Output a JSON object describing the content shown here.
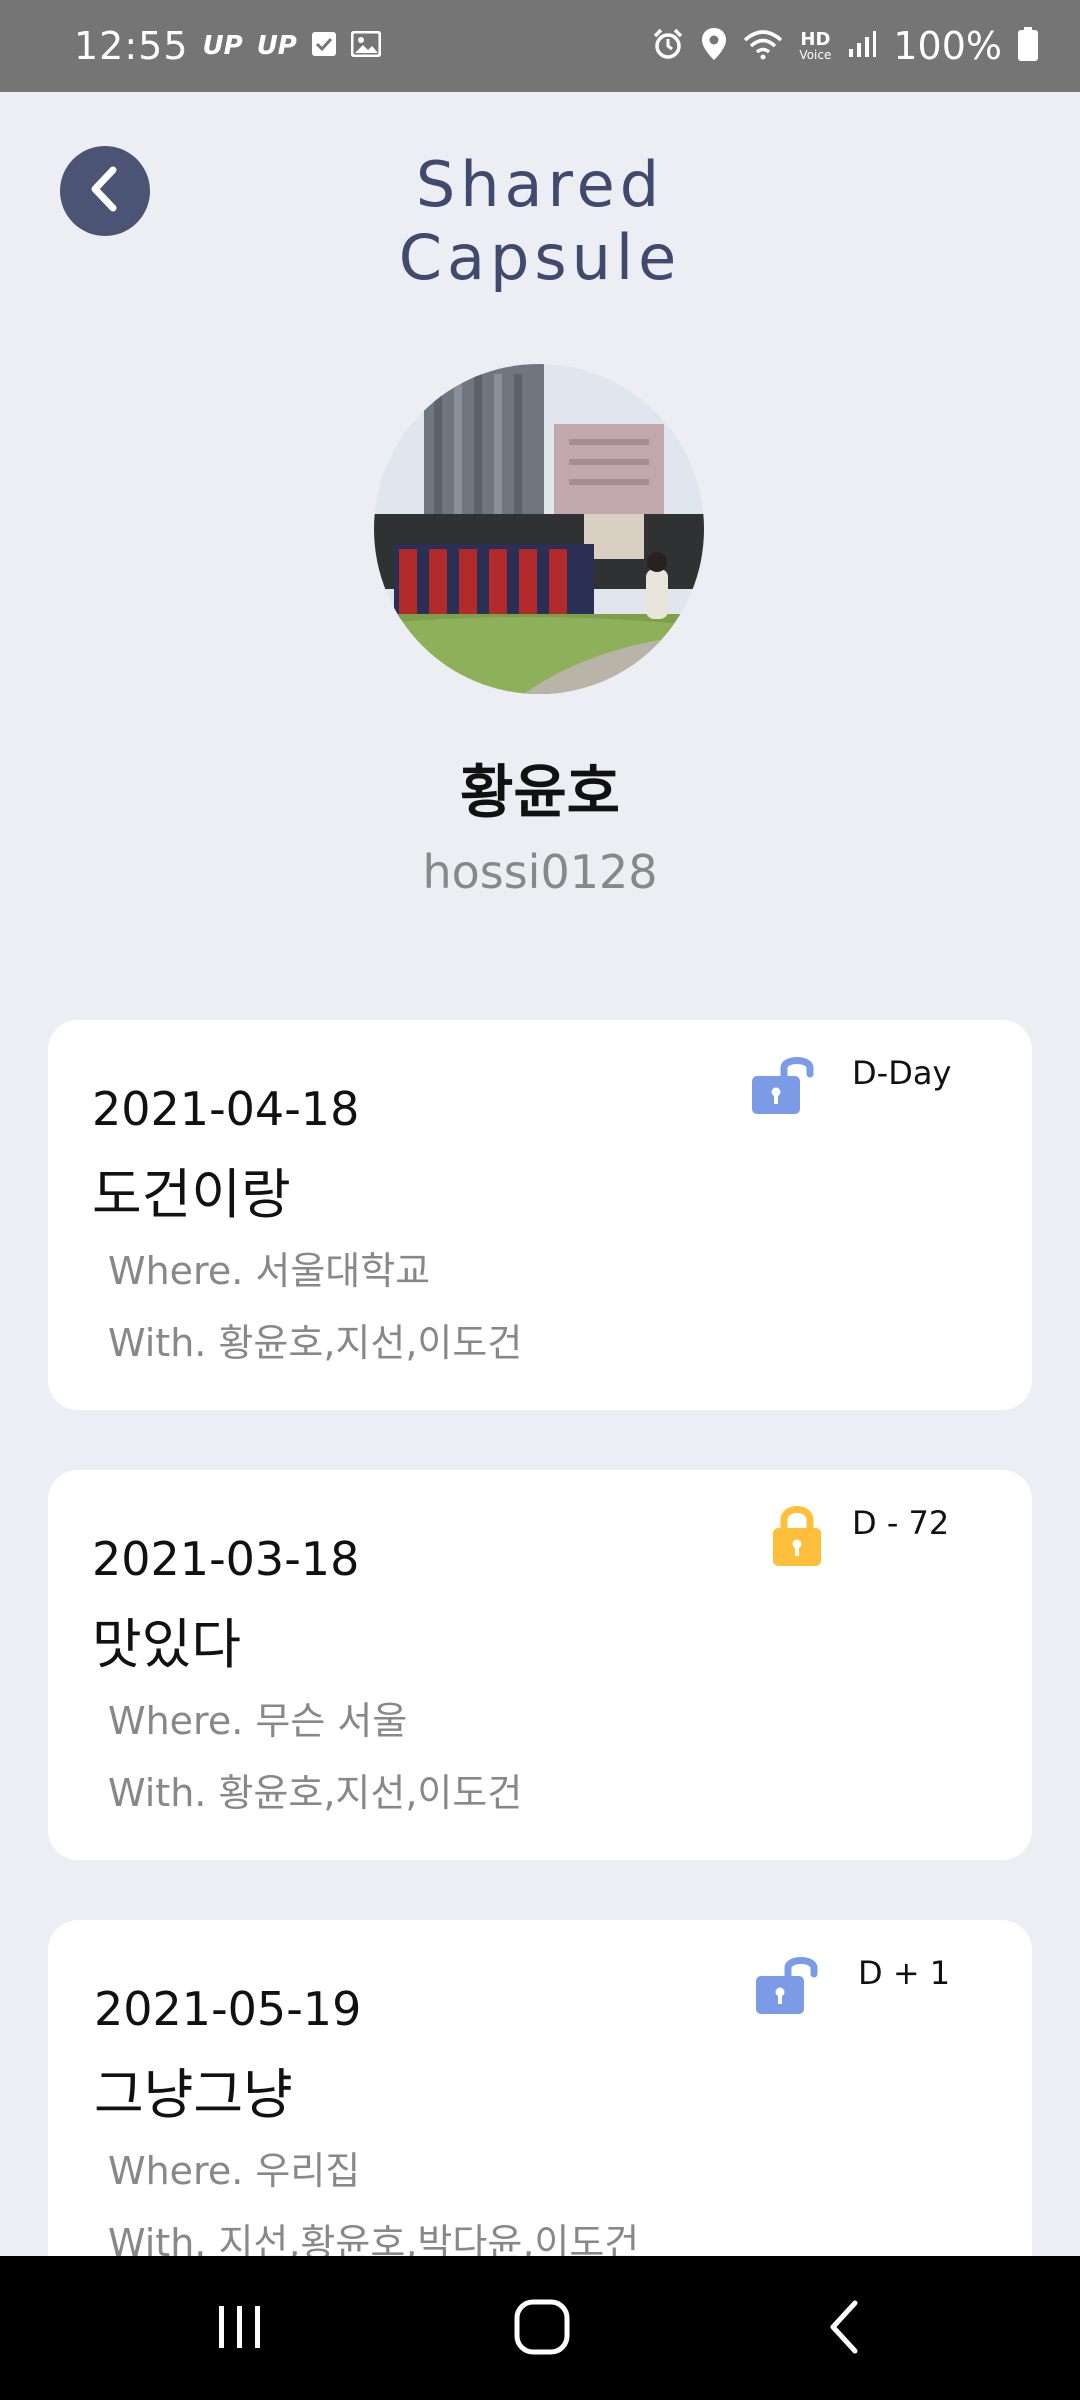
{
  "status_bar": {
    "time": "12:55",
    "up1": "UP",
    "up2": "UP",
    "hd": "HD",
    "voice": "Voice",
    "battery": "100%"
  },
  "header": {
    "title": "Shared Capsule"
  },
  "profile": {
    "name": "황윤호",
    "user_id": "hossi0128"
  },
  "capsules": [
    {
      "date": "2021-04-18",
      "title": "도건이랑",
      "where": "Where. 서울대학교",
      "with": "With. 황윤호,지선,이도건",
      "lock": "unlocked",
      "dday": "D-Day"
    },
    {
      "date": "2021-03-18",
      "title": "맛있다",
      "where": "Where. 무슨 서울",
      "with": "With. 황윤호,지선,이도건",
      "lock": "locked",
      "dday": "D - 72"
    },
    {
      "date": "2021-05-19",
      "title": "그냥그냥",
      "where": "Where. 우리집",
      "with": "With. 지선,황윤호,박다윤,이도건",
      "lock": "unlocked",
      "dday": "D + 1"
    }
  ],
  "colors": {
    "background": "#eceef3",
    "accent": "#4b5475",
    "title": "#3f4a6e",
    "unlocked": "#7b9be6",
    "locked": "#ffbf3a"
  },
  "icons": {
    "back": "chevron-left-icon",
    "unlocked": "unlocked-padlock-icon",
    "locked": "locked-padlock-icon"
  }
}
